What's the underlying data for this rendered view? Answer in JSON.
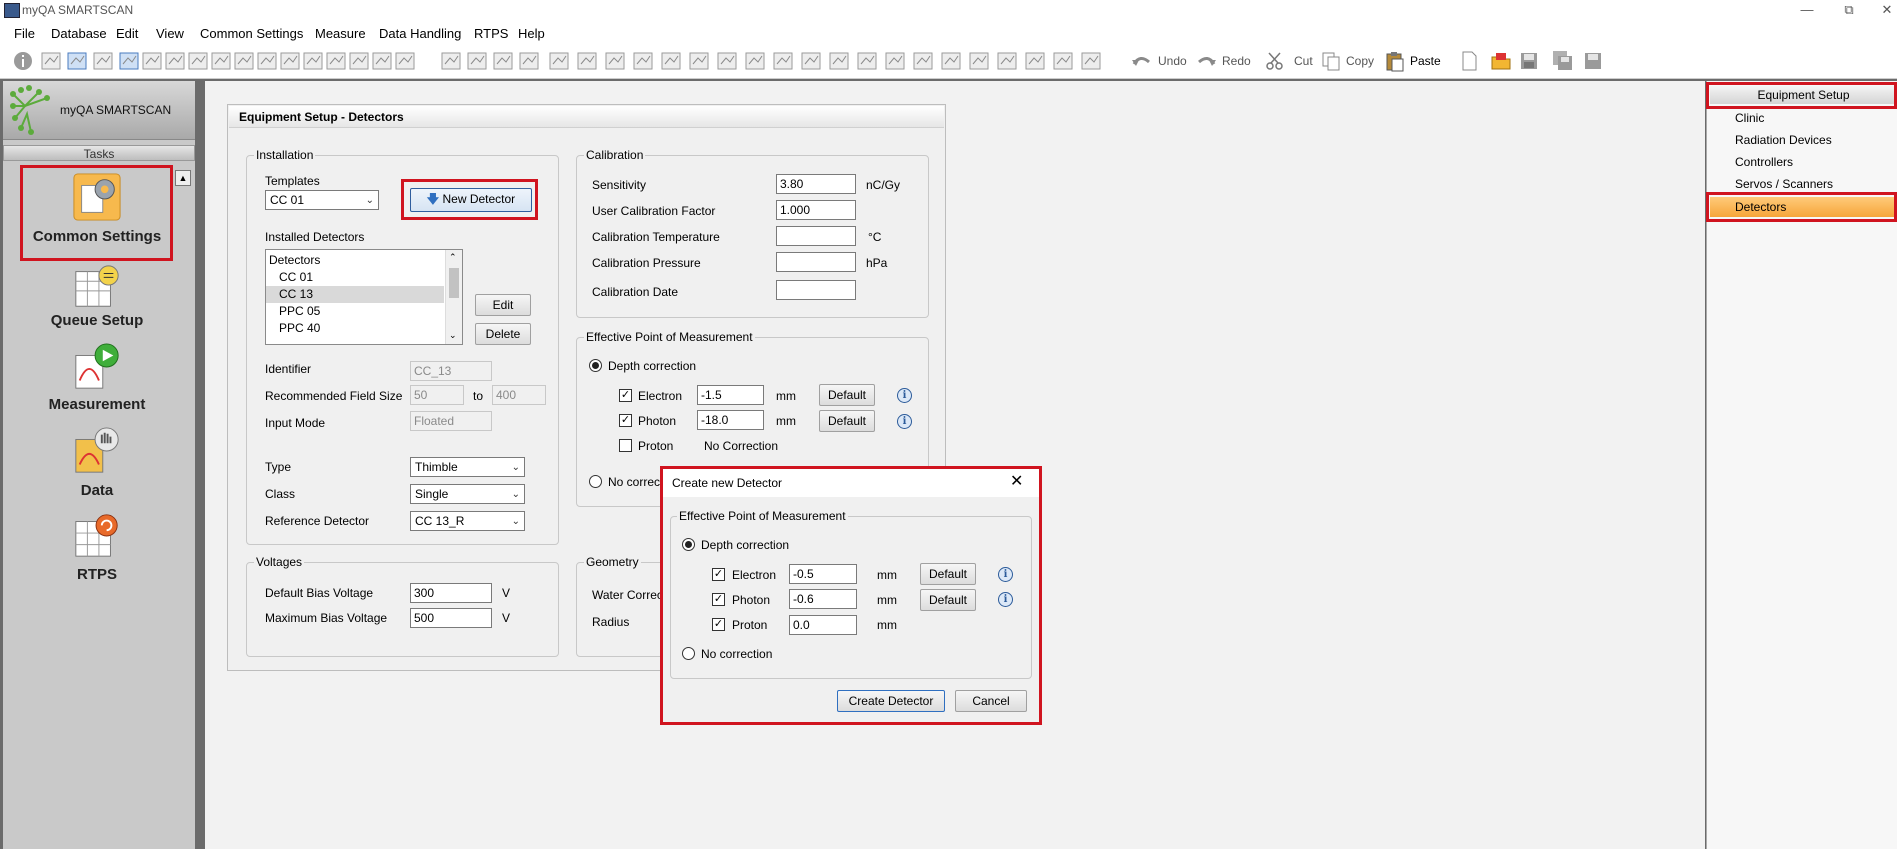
{
  "window": {
    "title": "myQA SMARTSCAN"
  },
  "menu": [
    "File",
    "Database",
    "Edit",
    "View",
    "Common Settings",
    "Measure",
    "Data Handling",
    "RTPS",
    "Help"
  ],
  "toolbar": {
    "undo": "Undo",
    "redo": "Redo",
    "cut": "Cut",
    "copy": "Copy",
    "paste": "Paste"
  },
  "sidebar": {
    "logo_text": "myQA SMARTSCAN",
    "tasks_header": "Tasks",
    "tasks": [
      "Common Settings",
      "Queue Setup",
      "Measurement",
      "Data",
      "RTPS"
    ]
  },
  "panel": {
    "title": "Equipment Setup - Detectors",
    "installation": {
      "group_title": "Installation",
      "templates_label": "Templates",
      "template_value": "CC 01",
      "new_detector": "New Detector",
      "installed_label": "Installed Detectors",
      "list_header": "Detectors",
      "list_items": [
        "CC 01",
        "CC 13",
        "PPC 05",
        "PPC 40"
      ],
      "edit": "Edit",
      "delete": "Delete",
      "identifier_label": "Identifier",
      "identifier": "CC_13",
      "field_size_label": "Recommended Field Size",
      "field_min": "50",
      "to": "to",
      "field_max": "400",
      "input_mode_label": "Input Mode",
      "input_mode": "Floated",
      "type_label": "Type",
      "type": "Thimble",
      "class_label": "Class",
      "class": "Single",
      "reference_label": "Reference Detector",
      "reference": "CC 13_R"
    },
    "voltages": {
      "group_title": "Voltages",
      "default_label": "Default Bias Voltage",
      "default_value": "300",
      "max_label": "Maximum Bias Voltage",
      "max_value": "500",
      "unit": "V"
    },
    "calibration": {
      "group_title": "Calibration",
      "sensitivity_label": "Sensitivity",
      "sensitivity": "3.80",
      "sensitivity_unit": "nC/Gy",
      "ucf_label": "User Calibration Factor",
      "ucf": "1.000",
      "temp_label": "Calibration Temperature",
      "temp_unit": "°C",
      "pressure_label": "Calibration Pressure",
      "pressure_unit": "hPa",
      "date_label": "Calibration Date"
    },
    "epom": {
      "group_title": "Effective Point of Measurement",
      "depth": "Depth correction",
      "electron": "Electron",
      "electron_value": "-1.5",
      "photon": "Photon",
      "photon_value": "-18.0",
      "proton": "Proton",
      "no_correction_text": "No Correction",
      "mm": "mm",
      "default": "Default",
      "no_correction_radio": "No correctio"
    },
    "geometry": {
      "group_title": "Geometry",
      "water_label": "Water Correctio",
      "radius_label": "Radius"
    }
  },
  "dialog": {
    "title": "Create new Detector",
    "group_title": "Effective Point of Measurement",
    "depth": "Depth correction",
    "electron": "Electron",
    "electron_value": "-0.5",
    "photon": "Photon",
    "photon_value": "-0.6",
    "proton": "Proton",
    "proton_value": "0.0",
    "mm": "mm",
    "default": "Default",
    "no_correction": "No correction",
    "create": "Create Detector",
    "cancel": "Cancel"
  },
  "right_panel": {
    "header": "Equipment Setup",
    "items": [
      "Clinic",
      "Radiation Devices",
      "Controllers",
      "Servos / Scanners",
      "Detectors"
    ],
    "selected": "Detectors"
  },
  "colors": {
    "highlight_red": "#d0141f",
    "selected_orange": "#f6a53a",
    "frame_gray": "#6b6b6b"
  }
}
